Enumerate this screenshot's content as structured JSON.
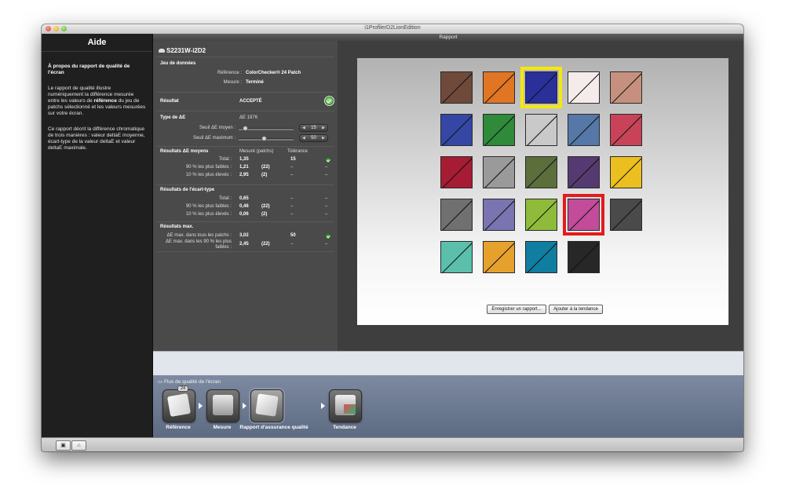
{
  "window": {
    "title": "i1ProfilerD2LionEdition",
    "header": "Rapport"
  },
  "help": {
    "title": "Aide",
    "heading": "À propos du rapport de qualité de l'écran",
    "p1_a": "Le rapport de qualité illustre numériquement la différence mesurée entre les valeurs de",
    "p1_b": "référence",
    "p1_c": "du jeu de patchs sélectionné et les valeurs mesurées sur votre écran.",
    "p2": "Ce rapport décrit la différence chromatique de trois manières : valeur deltaE moyenne, écart-type de la valeur deltaE et valeur deltaE maximale."
  },
  "results": {
    "device": "S2231W-i2D2",
    "dataset": {
      "title": "Jeu de données",
      "ref_label": "Référence :",
      "ref_value": "ColorChecker® 24 Patch",
      "mesure_label": "Mesure :",
      "mesure_value": "Terminé"
    },
    "resultat": {
      "label": "Résultat",
      "value": "ACCEPTÉ"
    },
    "delta_type": {
      "label": "Type de ΔE",
      "value": "ΔE 1976",
      "seuil_moyen_label": "Seuil ΔE moyen :",
      "seuil_moyen": "15",
      "seuil_max_label": "Seuil ΔE maximum :",
      "seuil_max": "50"
    },
    "moyens": {
      "title": "Résultats ΔE moyens",
      "col_measured": "Mesuré (patchs)",
      "col_tolerance": "Tolérance",
      "rows": [
        {
          "label": "Total :",
          "value": "1,35",
          "patches": "",
          "tol": "15"
        },
        {
          "label": "90 % les plus faibles :",
          "value": "1,21",
          "patches": "(22)",
          "tol": "–"
        },
        {
          "label": "10 % les plus élevés :",
          "value": "2,95",
          "patches": "(2)",
          "tol": "–"
        }
      ]
    },
    "ecart": {
      "title": "Résultats de l'écart-type",
      "rows": [
        {
          "label": "Total :",
          "value": "0,65",
          "patches": "",
          "tol": "–"
        },
        {
          "label": "90 % les plus faibles :",
          "value": "0,46",
          "patches": "(22)",
          "tol": "–"
        },
        {
          "label": "10 % les plus élevés :",
          "value": "0,06",
          "patches": "(2)",
          "tol": "–"
        }
      ]
    },
    "max": {
      "title": "Résultats max.",
      "row1_label": "ΔE max. dans tous les patchs :",
      "row1_value": "3,02",
      "row1_tol": "50",
      "row2_label_a": "ΔE max. dans les 90 % les plus",
      "row2_label_b": "faibles :",
      "row2_value": "2,45",
      "row2_patches": "(22)",
      "row2_tol": "–"
    },
    "dash": "–"
  },
  "patches": {
    "colors": [
      [
        "#6f4a3a",
        "#e07624",
        "#2a2f9a",
        "#f4ecea",
        "#c6907e"
      ],
      [
        "#3447a4",
        "#2f8a3a",
        "#c9c9c9",
        "#5578a6",
        "#c84358"
      ],
      [
        "#a61c33",
        "#9a9a9a",
        "#5b6e3c",
        "#553a71",
        "#ecbf21"
      ],
      [
        "#707070",
        "#7a74b0",
        "#8fbb3a",
        "#c34c9a",
        "#4a4a4a"
      ],
      [
        "#5bbfab",
        "#e6a12c",
        "#107ea0",
        "#272727",
        ""
      ]
    ]
  },
  "buttons": {
    "save_report": "Enregistrer un rapport...",
    "add_trend": "Ajouter à la tendance"
  },
  "flow": {
    "title": "Flux de qualité de l'écran",
    "badge": "24",
    "steps": [
      "Référence",
      "Mesure",
      "Rapport d'assurance qualité",
      "Tendance"
    ]
  }
}
